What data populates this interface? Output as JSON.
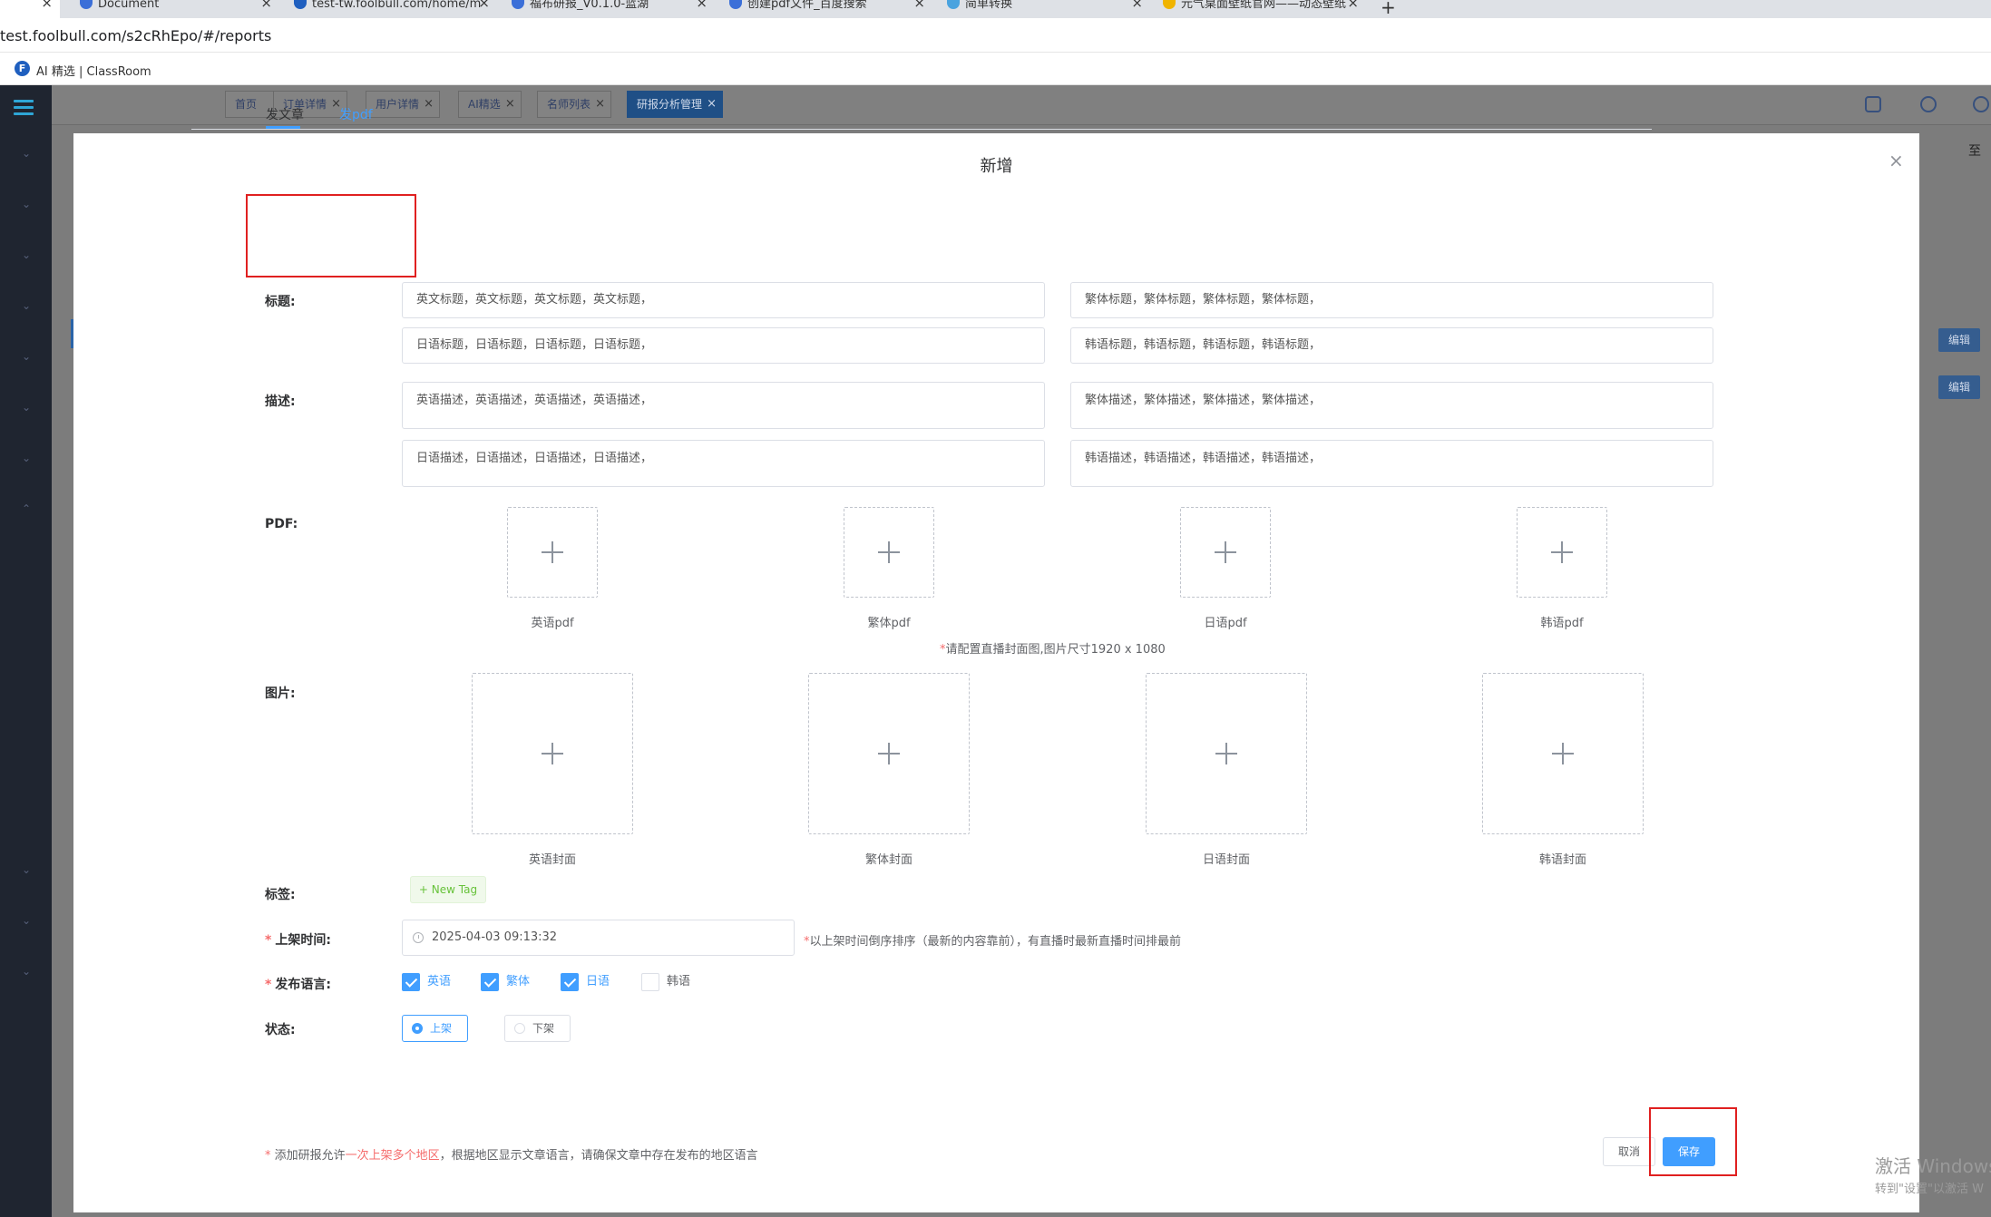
{
  "browser": {
    "tabs": [
      {
        "title": "Document"
      },
      {
        "title": "test-tw.foolbull.com/home/m"
      },
      {
        "title": "福布研报_V0.1.0-蓝湖"
      },
      {
        "title": "创建pdf文件_百度搜索"
      },
      {
        "title": "简单转换"
      },
      {
        "title": "元气桌面壁纸官网——动态壁纸"
      }
    ],
    "url": "test.foolbull.com/s2cRhEpo/#/reports",
    "bookmark": {
      "icon_letter": "F",
      "label": "AI 精选 | ClassRoom"
    }
  },
  "app": {
    "nav_tabs": [
      {
        "label": "首页"
      },
      {
        "label": "订单详情"
      },
      {
        "label": "用户详情"
      },
      {
        "label": "AI精选"
      },
      {
        "label": "名师列表"
      },
      {
        "label": "研报分析管理"
      }
    ],
    "edit_label": "编辑",
    "corner_text": "至"
  },
  "modal": {
    "title": "新增",
    "tabs": [
      {
        "label": "发文章"
      },
      {
        "label": "发pdf"
      }
    ],
    "title_field": {
      "label": "标题:",
      "en": "英文标题，英文标题，英文标题，英文标题，",
      "tw": "繁体标题，繁体标题，繁体标题，繁体标题，",
      "jp": "日语标题，日语标题，日语标题，日语标题，",
      "kr": "韩语标题，韩语标题，韩语标题，韩语标题，"
    },
    "desc_field": {
      "label": "描述:",
      "en": "英语描述，英语描述，英语描述，英语描述，",
      "tw": "繁体描述，繁体描述，繁体描述，繁体描述，",
      "jp": "日语描述，日语描述，日语描述，日语描述，",
      "kr": "韩语描述，韩语描述，韩语描述，韩语描述，"
    },
    "pdf_field": {
      "label": "PDF:",
      "captions": [
        "英语pdf",
        "繁体pdf",
        "日语pdf",
        "韩语pdf"
      ],
      "hint": "请配置直播封面图,图片尺寸1920 x 1080"
    },
    "image_field": {
      "label": "图片:",
      "captions": [
        "英语封面",
        "繁体封面",
        "日语封面",
        "韩语封面"
      ]
    },
    "tags_field": {
      "label": "标签:",
      "new_tag": "+ New Tag"
    },
    "time_field": {
      "label": "上架时间:",
      "value": "2025-04-03 09:13:32",
      "hint": "以上架时间倒序排序（最新的内容靠前），有直播时最新直播时间排最前"
    },
    "lang_field": {
      "label": "发布语言:",
      "options": [
        {
          "label": "英语",
          "checked": true
        },
        {
          "label": "繁体",
          "checked": true
        },
        {
          "label": "日语",
          "checked": true
        },
        {
          "label": "韩语",
          "checked": false
        }
      ]
    },
    "status_field": {
      "label": "状态:",
      "options": [
        {
          "label": "上架",
          "selected": true
        },
        {
          "label": "下架",
          "selected": false
        }
      ]
    },
    "footnote": {
      "star": "*",
      "part1": " 添加研报允许",
      "highlight": "一次上架多个地区",
      "part2": "，根据地区显示文章语言，请确保文章中存在发布的地区语言"
    },
    "cancel_label": "取消",
    "save_label": "保存"
  },
  "watermark": {
    "line1": "激活 Windows",
    "line2": "转到\"设置\"以激活 W"
  },
  "colors": {
    "primary": "#409eff",
    "required": "#f56c6c",
    "annotation": "#e02020"
  }
}
